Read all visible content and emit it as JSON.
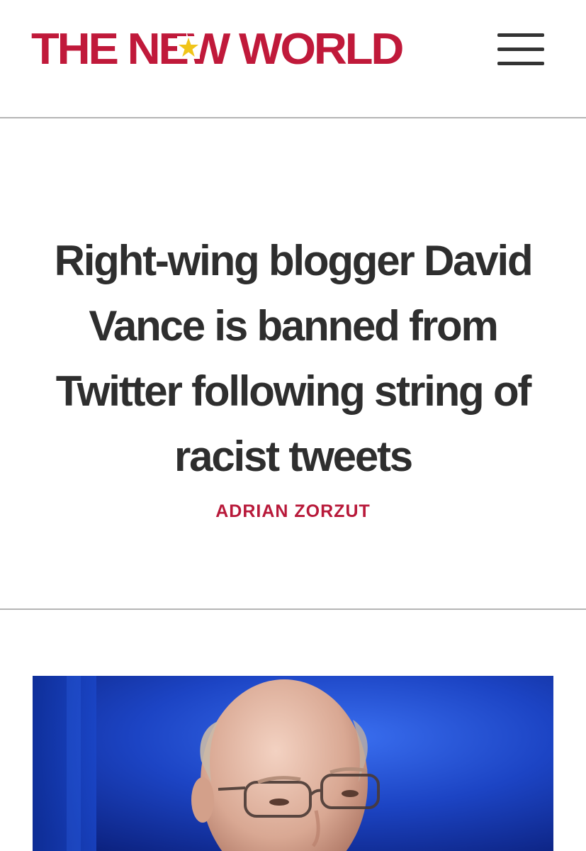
{
  "header": {
    "logo_text": "THE NEW WORLD",
    "logo_color": "#c0193a",
    "star_color": "#f0c419",
    "menu_icon": "hamburger-menu-icon"
  },
  "article": {
    "headline": "Right-wing blogger David Vance is banned from Twitter following string of racist tweets",
    "byline": "ADRIAN ZORZUT",
    "byline_color": "#b8193a",
    "headline_color": "#2e2e2e"
  },
  "photo": {
    "alt": "",
    "background_color": "#1a3fb8"
  }
}
